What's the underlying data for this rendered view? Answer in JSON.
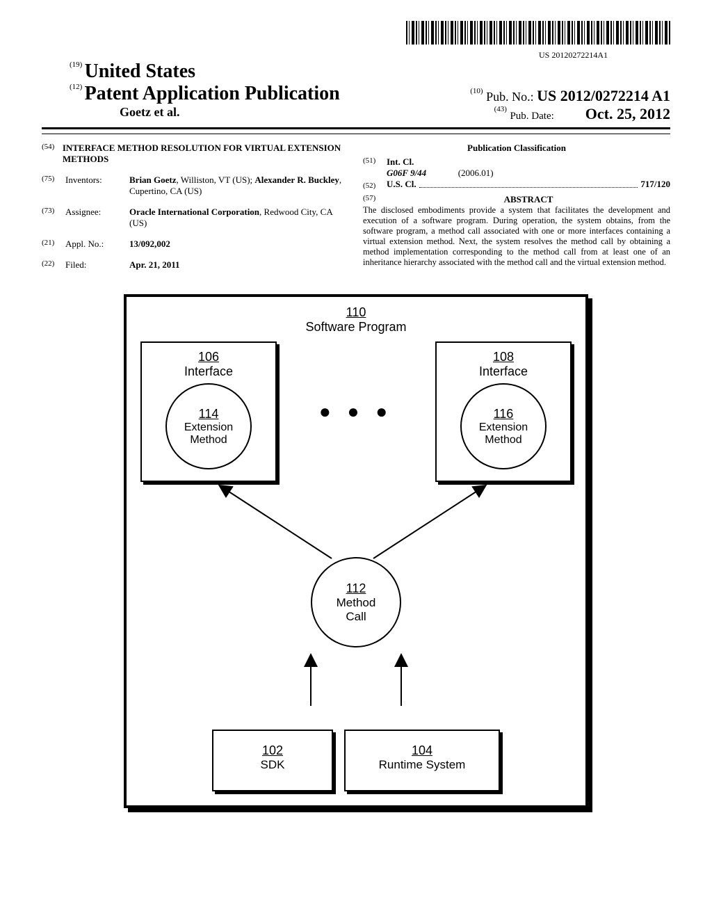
{
  "barcode_text": "US 20120272214A1",
  "header": {
    "code19": "(19)",
    "country": "United States",
    "code12": "(12)",
    "pub_type": "Patent Application Publication",
    "code10": "(10)",
    "pubno_label": "Pub. No.:",
    "pubno_value": "US 2012/0272214 A1",
    "authors": "Goetz et al.",
    "code43": "(43)",
    "pubdate_label": "Pub. Date:",
    "pubdate_value": "Oct. 25, 2012"
  },
  "left_biblio": {
    "code54": "(54)",
    "title": "INTERFACE METHOD RESOLUTION FOR VIRTUAL EXTENSION METHODS",
    "code75": "(75)",
    "inventors_label": "Inventors:",
    "inventors_value": "Brian Goetz, Williston, VT (US); Alexander R. Buckley, Cupertino, CA (US)",
    "inv1_name": "Brian Goetz",
    "inv1_loc": ", Williston, VT (US); ",
    "inv2_name": "Alexander R. Buckley",
    "inv2_loc": ", Cupertino, CA (US)",
    "code73": "(73)",
    "assignee_label": "Assignee:",
    "assignee_name": "Oracle International Corporation",
    "assignee_loc": ", Redwood City, CA (US)",
    "code21": "(21)",
    "applno_label": "Appl. No.:",
    "applno_value": "13/092,002",
    "code22": "(22)",
    "filed_label": "Filed:",
    "filed_value": "Apr. 21, 2011"
  },
  "right_biblio": {
    "pub_class_heading": "Publication Classification",
    "code51": "(51)",
    "intcl_label": "Int. Cl.",
    "intcl_code": "G06F 9/44",
    "intcl_date": "(2006.01)",
    "code52": "(52)",
    "uscl_label": "U.S. Cl.",
    "uscl_value": "717/120",
    "code57": "(57)",
    "abstract_heading": "ABSTRACT",
    "abstract_body": "The disclosed embodiments provide a system that facilitates the development and execution of a software program. During operation, the system obtains, from the software program, a method call associated with one or more interfaces containing a virtual extension method. Next, the system resolves the method call by obtaining a method implementation corresponding to the method call from at least one of an inheritance hierarchy associated with the method call and the virtual extension method."
  },
  "figure": {
    "ref110": "110",
    "lbl110": "Software Program",
    "ref106": "106",
    "lbl106": "Interface",
    "ref108": "108",
    "lbl108": "Interface",
    "ref114": "114",
    "lbl114a": "Extension",
    "lbl114b": "Method",
    "ref116": "116",
    "lbl116a": "Extension",
    "lbl116b": "Method",
    "ref112": "112",
    "lbl112a": "Method",
    "lbl112b": "Call",
    "ref102": "102",
    "lbl102": "SDK",
    "ref104": "104",
    "lbl104": "Runtime System",
    "dots": "● ● ●"
  }
}
